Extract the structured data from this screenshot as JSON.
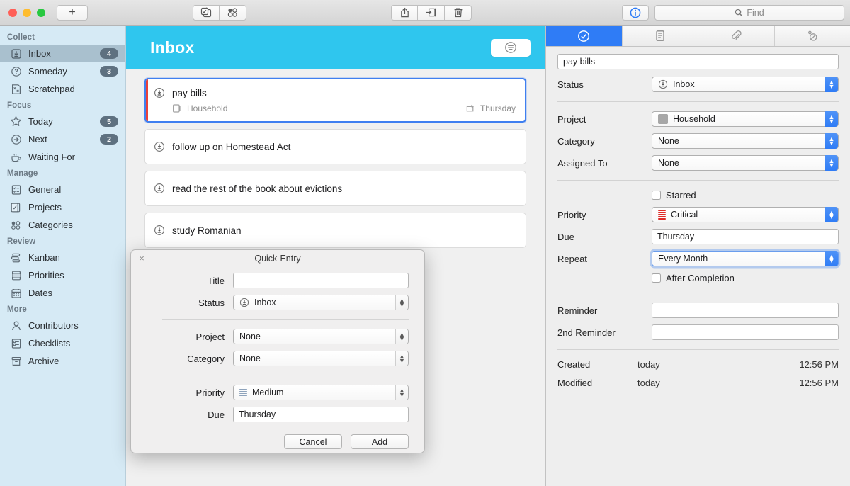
{
  "colors": {
    "accent_cyan": "#2fc6ee",
    "accent_blue": "#2f7cf6",
    "selection_blue": "#3f7ff0",
    "priority_critical_red": "#e8413c",
    "sidebar_bg": "#d6eaf5",
    "sidebar_selected": "#a9c0ce",
    "badge_bg": "#5e7180",
    "project_swatch_gray": "#a7a7a7"
  },
  "titlebar": {
    "new_tab_label": "+",
    "buttons": [
      {
        "name": "new-task-icon",
        "label": ""
      },
      {
        "name": "new-project-icon",
        "label": ""
      },
      {
        "name": "share-icon",
        "label": ""
      },
      {
        "name": "move-to-icon",
        "label": ""
      },
      {
        "name": "trash-icon",
        "label": ""
      },
      {
        "name": "info-icon",
        "label": ""
      }
    ],
    "search": {
      "placeholder": "Find",
      "value": "",
      "icon": "search-icon"
    }
  },
  "sidebar": {
    "groups": [
      {
        "title": "Collect",
        "items": [
          {
            "label": "Inbox",
            "icon": "inbox-icon",
            "badge": "4",
            "selected": true
          },
          {
            "label": "Someday",
            "icon": "question-circle-icon",
            "badge": "3",
            "selected": false
          },
          {
            "label": "Scratchpad",
            "icon": "scratchpad-icon",
            "badge": "",
            "selected": false
          }
        ]
      },
      {
        "title": "Focus",
        "items": [
          {
            "label": "Today",
            "icon": "star-icon",
            "badge": "5",
            "selected": false
          },
          {
            "label": "Next",
            "icon": "arrow-right-circle-icon",
            "badge": "2",
            "selected": false
          },
          {
            "label": "Waiting For",
            "icon": "coffee-cup-icon",
            "badge": "",
            "selected": false
          }
        ]
      },
      {
        "title": "Manage",
        "items": [
          {
            "label": "General",
            "icon": "list-icon",
            "badge": "",
            "selected": false
          },
          {
            "label": "Projects",
            "icon": "checkbox-stack-icon",
            "badge": "",
            "selected": false
          },
          {
            "label": "Categories",
            "icon": "dots-grid-icon",
            "badge": "",
            "selected": false
          }
        ]
      },
      {
        "title": "Review",
        "items": [
          {
            "label": "Kanban",
            "icon": "kanban-icon",
            "badge": "",
            "selected": false
          },
          {
            "label": "Priorities",
            "icon": "priorities-icon",
            "badge": "",
            "selected": false
          },
          {
            "label": "Dates",
            "icon": "calendar-icon",
            "badge": "",
            "selected": false
          }
        ]
      },
      {
        "title": "More",
        "items": [
          {
            "label": "Contributors",
            "icon": "person-icon",
            "badge": "",
            "selected": false
          },
          {
            "label": "Checklists",
            "icon": "checklist-icon",
            "badge": "",
            "selected": false
          },
          {
            "label": "Archive",
            "icon": "archive-box-icon",
            "badge": "",
            "selected": false
          }
        ]
      }
    ]
  },
  "main": {
    "header_title": "Inbox",
    "filter_button_icon": "filter-circle-icon",
    "tasks": [
      {
        "title": "pay bills",
        "icon": "inbox-icon",
        "selected": true,
        "priority_color": "#e8413c",
        "project": "Household",
        "project_icon": "project-icon",
        "due": "Thursday",
        "due_icon": "repeat-icon"
      },
      {
        "title": "follow up on Homestead Act",
        "icon": "inbox-icon",
        "selected": false,
        "project": "",
        "due": ""
      },
      {
        "title": "read the rest of the book about evictions",
        "icon": "inbox-icon",
        "selected": false,
        "project": "",
        "due": ""
      },
      {
        "title": "study Romanian",
        "icon": "inbox-icon",
        "selected": false,
        "project": "",
        "due": ""
      }
    ]
  },
  "inspector": {
    "tabs": [
      {
        "icon": "check-circle-icon",
        "label": "",
        "active": true
      },
      {
        "icon": "notes-icon",
        "label": "",
        "active": false
      },
      {
        "icon": "paperclip-icon",
        "label": "",
        "active": false
      },
      {
        "icon": "recurrence-icon",
        "label": "",
        "active": false
      }
    ],
    "title_value": "pay bills",
    "fields": {
      "status_label": "Status",
      "status_value": "Inbox",
      "status_icon": "inbox-icon",
      "project_label": "Project",
      "project_value": "Household",
      "category_label": "Category",
      "category_value": "None",
      "assigned_label": "Assigned To",
      "assigned_value": "None",
      "starred_label": "Starred",
      "starred_checked": false,
      "priority_label": "Priority",
      "priority_value": "Critical",
      "due_label": "Due",
      "due_value": "Thursday",
      "repeat_label": "Repeat",
      "repeat_value": "Every Month",
      "repeat_focused": true,
      "after_completion_label": "After Completion",
      "after_completion_checked": false,
      "reminder_label": "Reminder",
      "reminder_value": "",
      "reminder2_label": "2nd Reminder",
      "reminder2_value": ""
    },
    "meta": {
      "created_label": "Created",
      "created_value": "today",
      "created_time": "12:56 PM",
      "modified_label": "Modified",
      "modified_value": "today",
      "modified_time": "12:56 PM"
    }
  },
  "quick_entry": {
    "window_title": "Quick-Entry",
    "close_glyph": "×",
    "title_label": "Title",
    "title_value": "",
    "status_label": "Status",
    "status_value": "Inbox",
    "status_icon": "inbox-icon",
    "project_label": "Project",
    "project_value": "None",
    "category_label": "Category",
    "category_value": "None",
    "priority_label": "Priority",
    "priority_value": "Medium",
    "due_label": "Due",
    "due_value": "Thursday",
    "cancel_label": "Cancel",
    "add_label": "Add"
  }
}
